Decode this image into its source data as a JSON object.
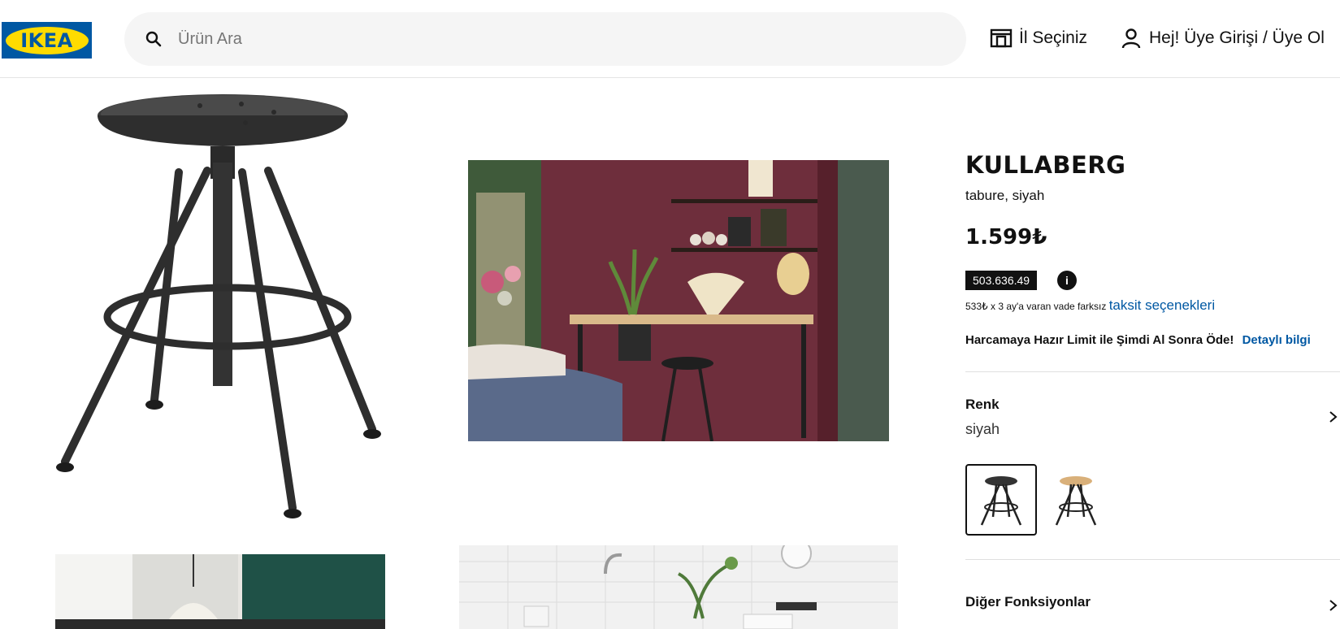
{
  "header": {
    "logo_text": "IKEA",
    "search_placeholder": "Ürün Ara",
    "store_label": "İl Seçiniz",
    "login_label": "Hej! Üye Girişi / Üye Ol"
  },
  "product": {
    "name": "KULLABERG",
    "description": "tabure, siyah",
    "price": "1.599₺",
    "price_badge": "503.636.49",
    "info_icon": "i",
    "installment_text": "533₺ x 3 ay'a varan vade farksız",
    "installment_link": "taksit seçenekleri",
    "limit_text": "Harcamaya Hazır Limit ile Şimdi Al Sonra Öde!",
    "limit_link": "Detaylı bilgi",
    "color_label": "Renk",
    "color_value": "siyah",
    "more_functions_label": "Diğer Fonksiyonlar"
  },
  "icons": {
    "search": "search-icon",
    "store": "store-icon",
    "user": "user-icon",
    "chevron": "chevron-right-icon",
    "info": "info-icon"
  },
  "colors": {
    "ikea_blue": "#0058a3",
    "ikea_yellow": "#ffdb00",
    "link_blue": "#0058a3",
    "search_bg": "#f5f5f5",
    "text": "#111111"
  }
}
